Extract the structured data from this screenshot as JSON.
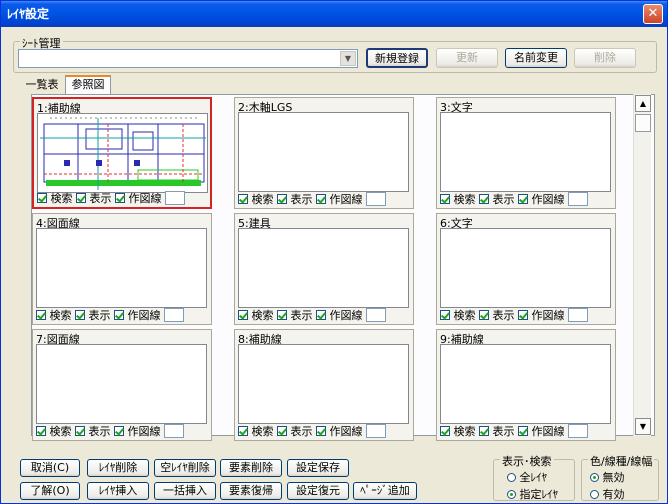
{
  "window": {
    "title": "ﾚｲﾔ設定",
    "close_glyph": "✕"
  },
  "sheet": {
    "group_label": "ｼｰﾄ管理",
    "value": "",
    "buttons": {
      "new": "新規登録",
      "update": "更新",
      "rename": "名前変更",
      "delete": "削除"
    }
  },
  "tabs": [
    {
      "label": "一覧表"
    },
    {
      "label": "参照図"
    }
  ],
  "panels": [
    {
      "title": "1:補助線",
      "check_search": "検索",
      "check_show": "表示",
      "check_draw": "作図線"
    },
    {
      "title": "2:木軸LGS",
      "check_search": "検索",
      "check_show": "表示",
      "check_draw": "作図線"
    },
    {
      "title": "3:文字",
      "check_search": "検索",
      "check_show": "表示",
      "check_draw": "作図線"
    },
    {
      "title": "4:図面線",
      "check_search": "検索",
      "check_show": "表示",
      "check_draw": "作図線"
    },
    {
      "title": "5:建具",
      "check_search": "検索",
      "check_show": "表示",
      "check_draw": "作図線"
    },
    {
      "title": "6:文字",
      "check_search": "検索",
      "check_show": "表示",
      "check_draw": "作図線"
    },
    {
      "title": "7:図面線",
      "check_search": "検索",
      "check_show": "表示",
      "check_draw": "作図線"
    },
    {
      "title": "8:補助線",
      "check_search": "検索",
      "check_show": "表示",
      "check_draw": "作図線"
    },
    {
      "title": "9:補助線",
      "check_search": "検索",
      "check_show": "表示",
      "check_draw": "作図線"
    }
  ],
  "bottom": {
    "cancel": "取消(C)",
    "ok": "了解(O)",
    "layer_delete": "ﾚｲﾔ削除",
    "layer_insert": "ﾚｲﾔ挿入",
    "empty_layer_delete": "空ﾚｲﾔ削除",
    "bulk_insert": "一括挿入",
    "element_delete": "要素削除",
    "element_restore": "要素復帰",
    "save_settings": "設定保存",
    "restore_settings": "設定復元",
    "add_page": "ﾍﾟｰｼﾞ追加"
  },
  "display_group": {
    "label": "表示･検索",
    "opt_all": "全ﾚｲﾔ",
    "opt_specified": "指定ﾚｲﾔ"
  },
  "color_group": {
    "label": "色/線種/線幅",
    "opt_none": "無効",
    "opt_enabled": "有効"
  }
}
